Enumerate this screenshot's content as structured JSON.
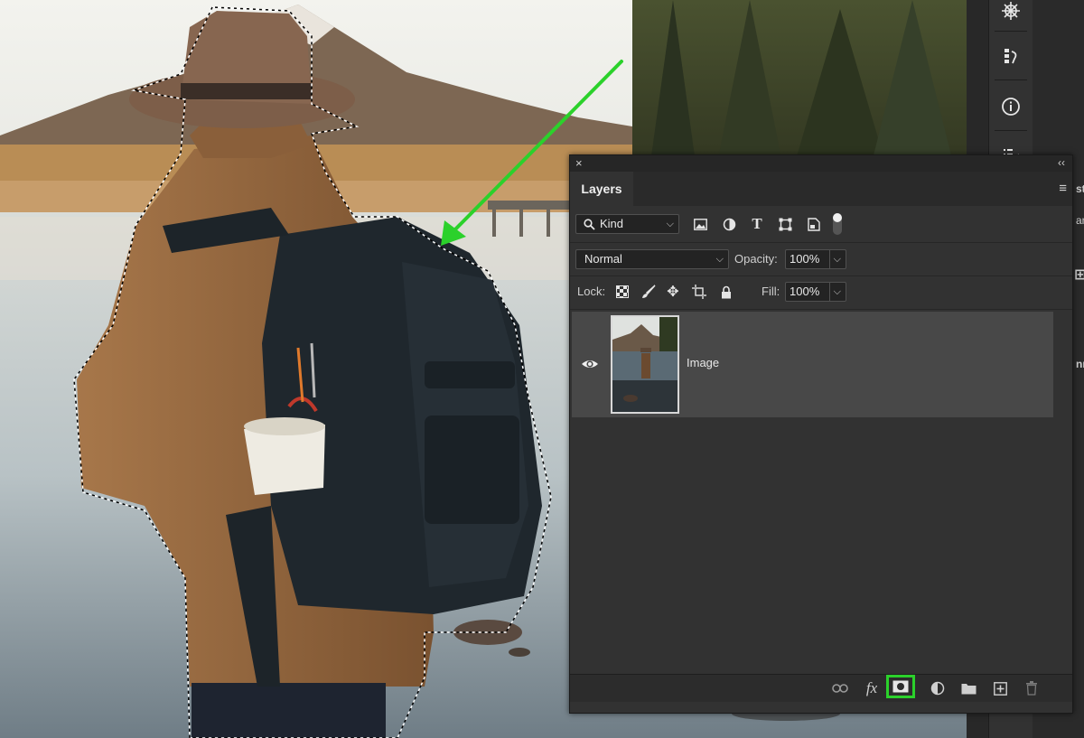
{
  "layers_panel": {
    "close_glyph": "×",
    "collapse_glyph": "‹‹",
    "tab_label": "Layers",
    "menu_glyph": "≡",
    "filter": {
      "kind_label": "Kind"
    },
    "blend_mode": "Normal",
    "opacity_label": "Opacity:",
    "opacity_value": "100%",
    "lock_label": "Lock:",
    "fill_label": "Fill:",
    "fill_value": "100%",
    "layers": [
      {
        "name": "Image",
        "visible": true
      }
    ],
    "footer": {
      "buttons": [
        "link-icon",
        "fx-icon",
        "add-mask-icon",
        "adjustment-icon",
        "folder-icon",
        "new-layer-icon",
        "trash-icon"
      ],
      "fx_label": "fx",
      "highlighted_button": "add-mask-icon"
    }
  },
  "dock": {
    "icons": [
      "navigator-icon",
      "history-icon",
      "info-icon",
      "properties-icon"
    ],
    "partial_labels": [
      "st",
      "an",
      "nn"
    ]
  },
  "colors": {
    "panel_bg": "#323232",
    "selected_layer_bg": "#484848",
    "highlight_green": "#2bd12b",
    "arrow_green": "#2bd12b"
  }
}
